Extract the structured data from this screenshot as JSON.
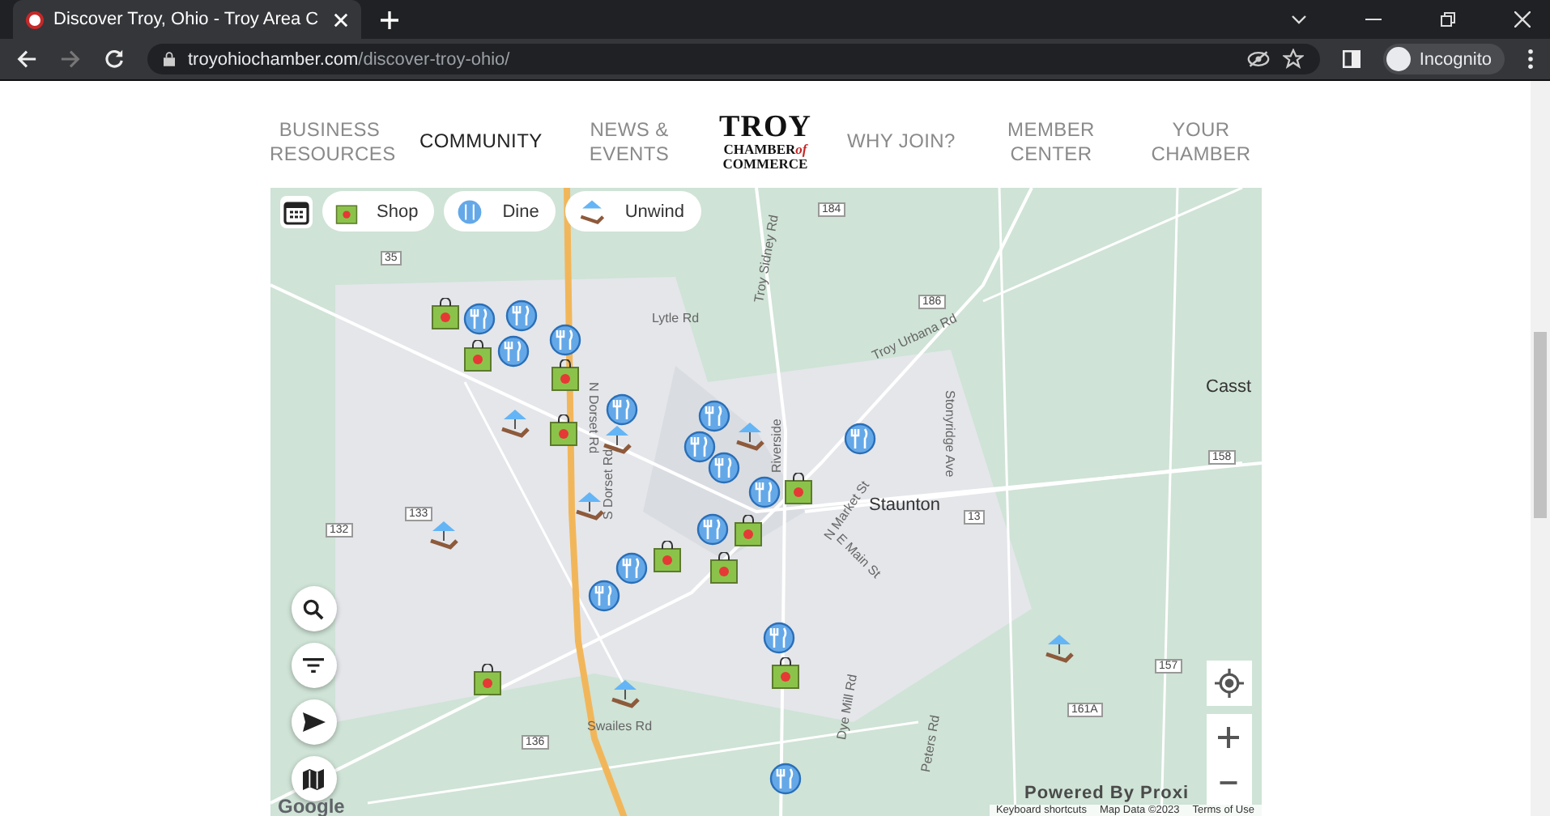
{
  "browser": {
    "tab_title": "Discover Troy, Ohio - Troy Area C",
    "url_domain": "troyohiochamber.com",
    "url_path": "/discover-troy-ohio/",
    "profile": "Incognito"
  },
  "nav": [
    {
      "label": "BUSINESS RESOURCES",
      "selected": false
    },
    {
      "label": "COMMUNITY",
      "selected": true
    },
    {
      "label": "NEWS & EVENTS",
      "selected": false
    },
    {
      "label": "WHY JOIN?",
      "selected": false
    },
    {
      "label": "MEMBER CENTER",
      "selected": false
    },
    {
      "label": "YOUR CHAMBER",
      "selected": false
    }
  ],
  "logo": {
    "name": "TROY",
    "line2": "CHAMBER",
    "of": "of",
    "line3": "COMMERCE"
  },
  "filters": [
    {
      "kind": "shop",
      "label": "Shop"
    },
    {
      "kind": "dine",
      "label": "Dine"
    },
    {
      "kind": "unwind",
      "label": "Unwind"
    }
  ],
  "map_labels": [
    "Lytle Rd",
    "Troy Sidney Rd",
    "Troy Urbana Rd",
    "N Dorset Rd",
    "S Dorset Rd",
    "Riverside",
    "N Market St",
    "Stonyridge Ave",
    "Staunton",
    "Casst",
    "E Main St",
    "Dye Mill Rd",
    "Peters Rd",
    "Swailes Rd"
  ],
  "route_shields": [
    "35",
    "184",
    "186",
    "133",
    "132",
    "13",
    "158",
    "136",
    "157",
    "161A"
  ],
  "attribution": {
    "logo": "Google",
    "powered": "Powered By Proxi",
    "shortcuts": "Keyboard shortcuts",
    "map_data": "Map Data ©2023",
    "terms": "Terms of Use"
  }
}
